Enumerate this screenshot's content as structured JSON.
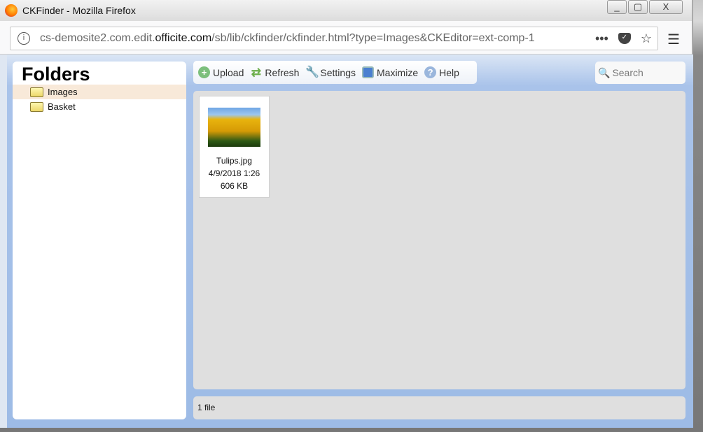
{
  "window": {
    "title": "CKFinder - Mozilla Firefox"
  },
  "browser": {
    "url_prefix": "cs-demosite2.com.edit.",
    "url_domain": "officite.com",
    "url_suffix": "/sb/lib/ckfinder/ckfinder.html?type=Images&CKEditor=ext-comp-1"
  },
  "folders": {
    "heading": "Folders",
    "items": [
      {
        "label": "Images",
        "selected": true
      },
      {
        "label": "Basket",
        "selected": false
      }
    ]
  },
  "toolbar": {
    "upload": "Upload",
    "refresh": "Refresh",
    "settings": "Settings",
    "maximize": "Maximize",
    "help": "Help"
  },
  "search": {
    "placeholder": "Search"
  },
  "files": [
    {
      "name": "Tulips.jpg",
      "date": "4/9/2018 1:26",
      "size": "606 KB"
    }
  ],
  "status": {
    "text": "1 file"
  }
}
